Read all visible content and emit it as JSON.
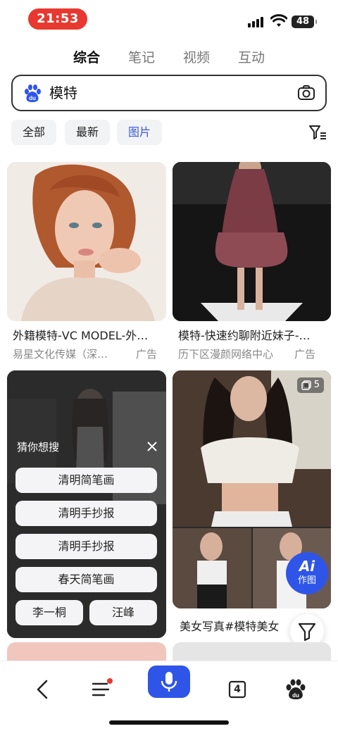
{
  "status_bar": {
    "time": "21:53",
    "battery": "48"
  },
  "tabs": [
    {
      "label": "综合",
      "active": true
    },
    {
      "label": "笔记",
      "active": false
    },
    {
      "label": "视频",
      "active": false
    },
    {
      "label": "互动",
      "active": false
    }
  ],
  "search": {
    "query": "模特",
    "logo_icon": "baidu-paw-icon",
    "camera_icon": "camera-icon"
  },
  "filters": {
    "chips": [
      {
        "label": "全部",
        "active": false
      },
      {
        "label": "最新",
        "active": false
      },
      {
        "label": "图片",
        "active": true
      }
    ],
    "filter_icon": "filter-icon"
  },
  "results": [
    {
      "title": "外籍模特-VC MODEL-外…",
      "source": "易星文化传媒（深…",
      "ad": "广告",
      "image": "woman-portrait"
    },
    {
      "title": "模特-快速约聊附近妹子-…",
      "source": "历下区漫颜网络中心",
      "ad": "广告",
      "image": "woman-pink-dress-runway"
    },
    {
      "title": "",
      "source": "",
      "ad": "",
      "image": "woman-white-top-street"
    },
    {
      "title": "美女写真#模特美女",
      "source": "",
      "ad": "",
      "image": "woman-white-crop-top",
      "count": "5"
    }
  ],
  "suggest": {
    "title": "猜你想搜",
    "items": [
      "清明简笔画",
      "清明手抄报",
      "清明手抄报",
      "春天简笔画"
    ],
    "pair": [
      "李一桐",
      "汪峰"
    ]
  },
  "ai_button": {
    "line1": "Ai",
    "line2": "作图"
  },
  "bottom_nav": {
    "tab_count": "4"
  },
  "colors": {
    "accent": "#2f55e8",
    "active_chip": "#3b5bd9",
    "time_pill": "#e8382f"
  }
}
